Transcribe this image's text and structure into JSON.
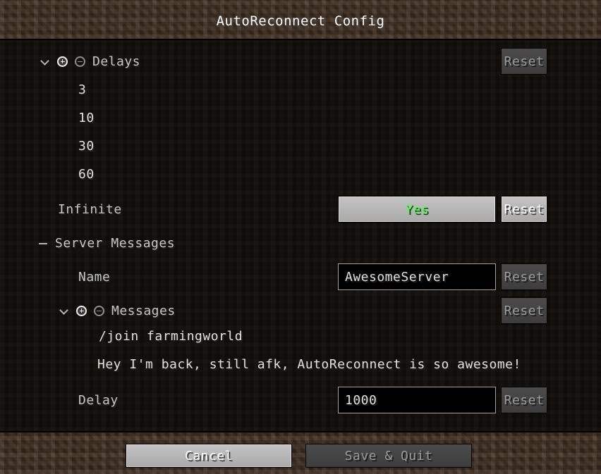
{
  "window": {
    "title": "AutoReconnect Config"
  },
  "config": {
    "delays": {
      "label": "Delays",
      "expand_icon": "chevron-down-icon",
      "add_icon": "plus-circle-icon",
      "remove_icon": "minus-circle-icon",
      "reset_label": "Reset",
      "items": [
        {
          "value": "3"
        },
        {
          "value": "10"
        },
        {
          "value": "30"
        },
        {
          "value": "60"
        }
      ]
    },
    "infinite": {
      "label": "Infinite",
      "value": "Yes",
      "reset_label": "Reset"
    },
    "server_messages": {
      "label": "Server Messages",
      "expand_icon": "dash-icon",
      "name": {
        "label": "Name",
        "value": "AwesomeServer",
        "reset_label": "Reset"
      },
      "messages": {
        "label": "Messages",
        "expand_icon": "chevron-down-icon",
        "add_icon": "plus-circle-icon",
        "remove_icon": "minus-circle-icon",
        "reset_label": "Reset",
        "items": [
          {
            "value": "/join farmingworld"
          },
          {
            "value": "Hey I'm back, still afk, AutoReconnect is so awesome!"
          }
        ]
      },
      "delay": {
        "label": "Delay",
        "value": "1000",
        "reset_label": "Reset"
      }
    }
  },
  "footer": {
    "cancel_label": "Cancel",
    "save_quit_label": "Save & Quit"
  },
  "colors": {
    "accent_green": "#55FF55",
    "dirt": "#3F2F22",
    "panel": "#120E0A",
    "text": "#C8C8C8"
  }
}
